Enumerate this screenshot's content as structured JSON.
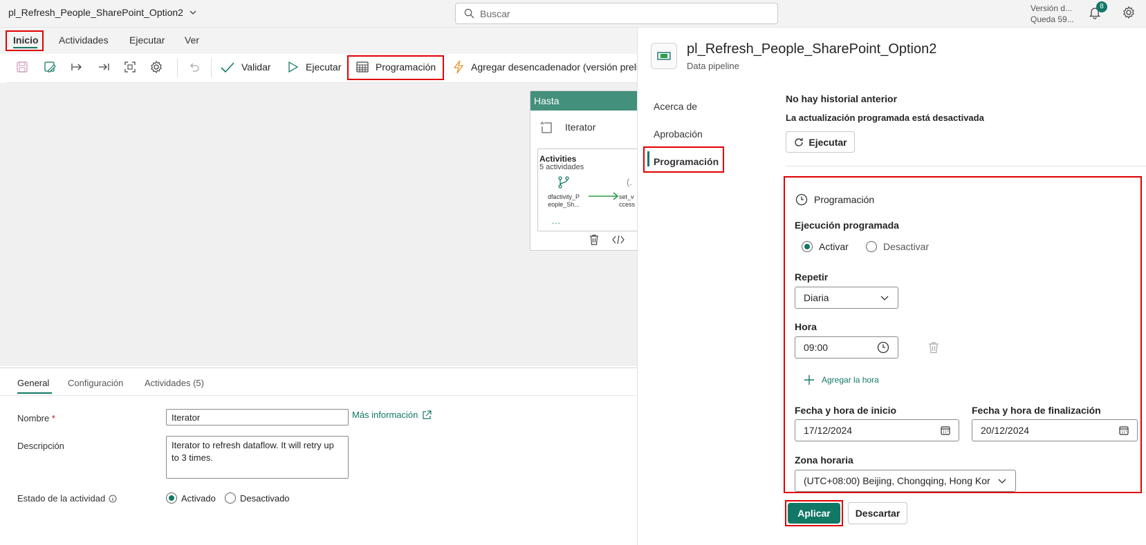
{
  "header": {
    "pipeline_title": "pl_Refresh_People_SharePoint_Option2",
    "search_placeholder": "Buscar",
    "version_line1": "Versión d...",
    "version_line2": "Queda 59...",
    "notification_count": "8"
  },
  "menu": {
    "tabs": [
      "Inicio",
      "Actividades",
      "Ejecutar",
      "Ver"
    ]
  },
  "toolbar": {
    "validate": "Validar",
    "run": "Ejecutar",
    "schedule": "Programación",
    "add_trigger": "Agregar desencadenador (versión preli"
  },
  "canvas": {
    "until_header": "Hasta",
    "iterator_label": "Iterator",
    "activities_title": "Activities",
    "activities_count": "5 actividades",
    "activity_1_line1": "dfactivity_P",
    "activity_1_line2": "eople_Sh...",
    "activity_2_line1": "set_v",
    "activity_2_line2": "ccess",
    "activity_2_icon": "(.",
    "more_dots": "..."
  },
  "bottom_panel": {
    "tabs": [
      "General",
      "Configuración",
      "Actividades (5)"
    ],
    "name_label": "Nombre",
    "required_mark": "*",
    "name_value": "Iterator",
    "more_info": "Más información",
    "description_label": "Descripción",
    "description_value": "Iterator to refresh dataflow. It will retry up to 3 times.",
    "state_label": "Estado de la actividad",
    "state_on": "Activado",
    "state_off": "Desactivado"
  },
  "side_panel": {
    "title": "pl_Refresh_People_SharePoint_Option2",
    "subtitle": "Data pipeline",
    "nav": [
      "Acerca de",
      "Aprobación",
      "Programación"
    ],
    "no_history": "No hay historial anterior",
    "refresh_off": "La actualización programada está desactivada",
    "run_button": "Ejecutar",
    "schedule_heading": "Programación",
    "scheduled_run_label": "Ejecución programada",
    "enable": "Activar",
    "disable": "Desactivar",
    "repeat_label": "Repetir",
    "repeat_value": "Diaria",
    "time_label": "Hora",
    "time_value": "09:00",
    "add_time": "Agregar la hora",
    "start_label": "Fecha y hora de inicio",
    "start_value": "17/12/2024",
    "end_label": "Fecha y hora de finalización",
    "end_value": "20/12/2024",
    "timezone_label": "Zona horaria",
    "timezone_value": "(UTC+08:00) Beijing, Chongqing, Hong Kor",
    "apply": "Aplicar",
    "discard": "Descartar"
  },
  "colors": {
    "accent": "#117865",
    "until_header": "#43907c",
    "highlight_box": "#e00000"
  }
}
